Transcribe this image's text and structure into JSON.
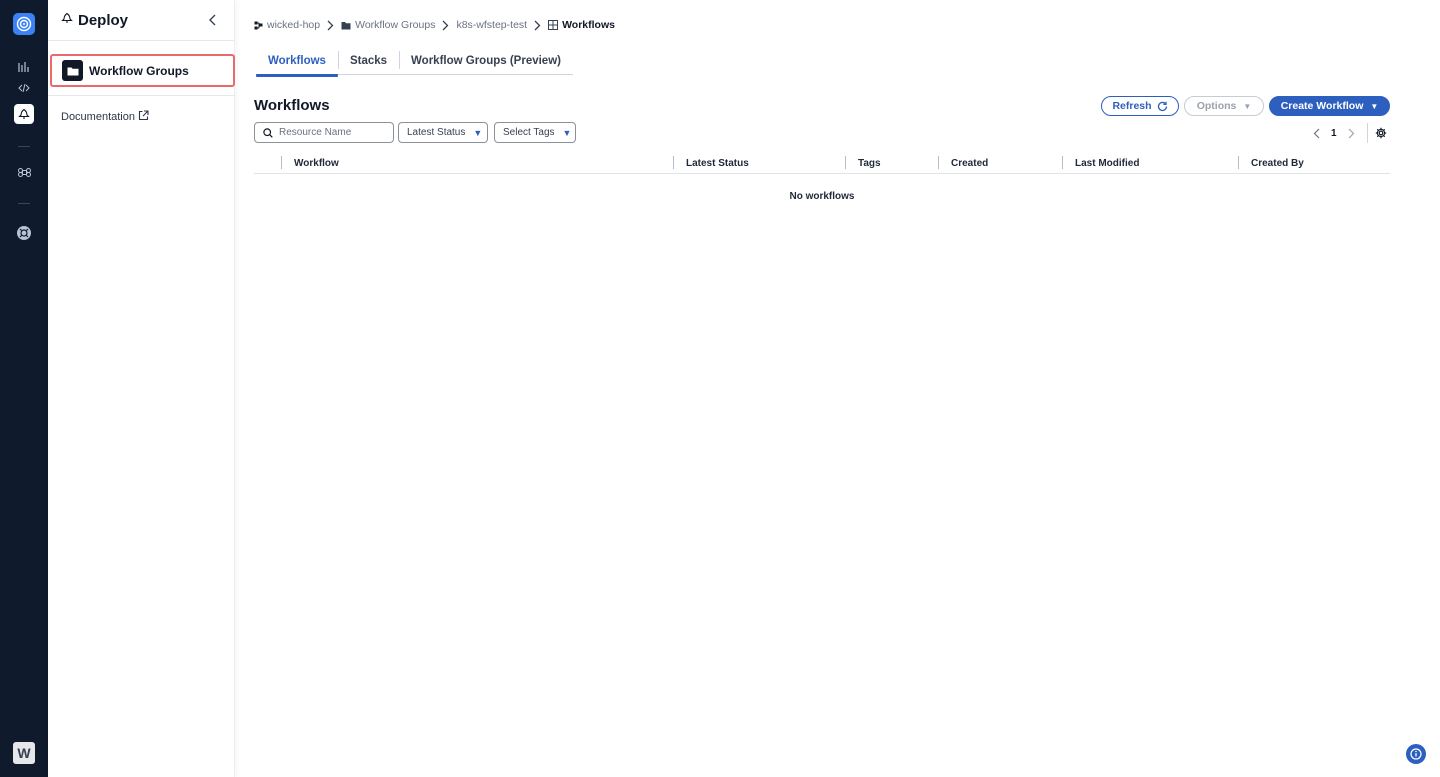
{
  "colors": {
    "accent": "#2d5fbf",
    "rail_bg": "#0f1b2d",
    "highlight_border": "#e86a6a"
  },
  "sidebar": {
    "title": "Deploy",
    "items": [
      {
        "label": "Workflow Groups",
        "icon": "folder-icon"
      }
    ],
    "doc_link": "Documentation"
  },
  "breadcrumb": {
    "items": [
      {
        "label": "wicked-hop",
        "icon": "org-icon"
      },
      {
        "label": "Workflow Groups",
        "icon": "folder-icon"
      },
      {
        "label": "k8s-wfstep-test",
        "icon": ""
      },
      {
        "label": "Workflows",
        "icon": "grid-icon"
      }
    ]
  },
  "tabs": [
    {
      "label": "Workflows",
      "active": true
    },
    {
      "label": "Stacks",
      "active": false
    },
    {
      "label": "Workflow Groups (Preview)",
      "active": false
    }
  ],
  "page": {
    "title": "Workflows",
    "refresh_label": "Refresh",
    "options_label": "Options",
    "create_label": "Create Workflow"
  },
  "filters": {
    "search_placeholder": "Resource Name",
    "status_label": "Latest Status",
    "tags_label": "Select Tags"
  },
  "pager": {
    "current": "1"
  },
  "table": {
    "columns": [
      "Workflow",
      "Latest Status",
      "Tags",
      "Created",
      "Last Modified",
      "Created By"
    ],
    "empty_text": "No workflows"
  },
  "rail": {
    "workspace_initial": "W"
  }
}
